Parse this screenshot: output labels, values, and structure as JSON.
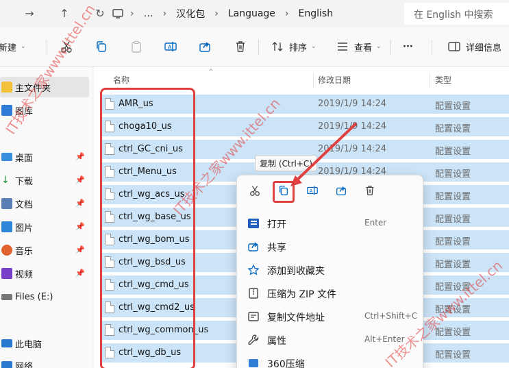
{
  "address_bar": {
    "breadcrumbs": [
      "汉化包",
      "Language",
      "English"
    ],
    "overflow": "…",
    "search_placeholder": "在 English 中搜索"
  },
  "toolbar": {
    "new_label": "新建",
    "sort_label": "排序",
    "view_label": "查看",
    "more": "···",
    "details_label": "详细信息"
  },
  "sidebar": {
    "items": [
      {
        "label": "主文件夹",
        "icon": "home-icon"
      },
      {
        "label": "图库",
        "icon": "gallery-icon"
      },
      {
        "label": "桌面",
        "icon": "desktop-icon"
      },
      {
        "label": "下载",
        "icon": "download-icon"
      },
      {
        "label": "文档",
        "icon": "document-icon"
      },
      {
        "label": "图片",
        "icon": "pictures-icon"
      },
      {
        "label": "音乐",
        "icon": "music-icon"
      },
      {
        "label": "视频",
        "icon": "video-icon"
      },
      {
        "label": "Files (E:)",
        "icon": "drive-icon"
      },
      {
        "label": "此电脑",
        "icon": "pc-icon"
      },
      {
        "label": "网络",
        "icon": "network-icon"
      }
    ]
  },
  "columns": {
    "name": "名称",
    "date": "修改日期",
    "type": "类型"
  },
  "files": [
    {
      "name": "AMR_us",
      "date": "2019/1/9 14:24",
      "type": "配置设置"
    },
    {
      "name": "choga10_us",
      "date": "2019/1/9 14:24",
      "type": "配置设置"
    },
    {
      "name": "ctrl_GC_cni_us",
      "date": "2019/1/9 14:24",
      "type": "配置设置"
    },
    {
      "name": "ctrl_Menu_us",
      "date": "2019/1/9 14:24",
      "type": "配置设置"
    },
    {
      "name": "ctrl_wg_acs_us",
      "date": "",
      "type": "配置设置"
    },
    {
      "name": "ctrl_wg_base_us",
      "date": "",
      "type": "配置设置"
    },
    {
      "name": "ctrl_wg_bom_us",
      "date": "",
      "type": "配置设置"
    },
    {
      "name": "ctrl_wg_bsd_us",
      "date": "",
      "type": "配置设置"
    },
    {
      "name": "ctrl_wg_cmd_us",
      "date": "",
      "type": "配置设置"
    },
    {
      "name": "ctrl_wg_cmd2_us",
      "date": "",
      "type": "配置设置"
    },
    {
      "name": "ctrl_wg_common_us",
      "date": "",
      "type": "配置设置"
    },
    {
      "name": "ctrl_wg_db_us",
      "date": "",
      "type": "配置设置"
    }
  ],
  "tooltip": "复制 (Ctrl+C)",
  "context_menu": {
    "items": [
      {
        "label": "打开",
        "shortcut": "Enter"
      },
      {
        "label": "共享",
        "shortcut": ""
      },
      {
        "label": "添加到收藏夹",
        "shortcut": ""
      },
      {
        "label": "压缩为 ZIP 文件",
        "shortcut": ""
      },
      {
        "label": "复制文件地址",
        "shortcut": "Ctrl+Shift+C"
      },
      {
        "label": "属性",
        "shortcut": "Alt+Enter"
      },
      {
        "label": "360压缩",
        "shortcut": ""
      }
    ]
  },
  "watermarks": [
    "IT技术之家www.ittel.cn",
    "IT技术之家www.ittel.cn",
    "IT技术之家www.ittel.cn"
  ],
  "colors": {
    "selection": "#cce4f7",
    "highlight": "#e04040",
    "accent": "#0067c0"
  }
}
